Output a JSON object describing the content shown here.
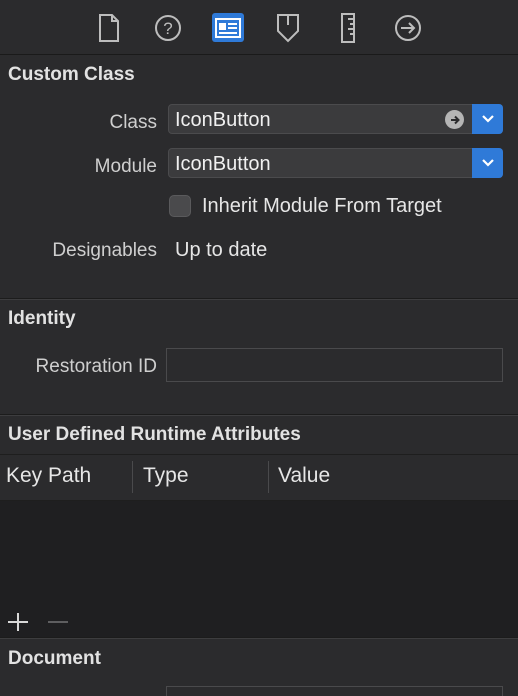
{
  "toolbar": {
    "icons": [
      "file-icon",
      "help-icon",
      "identity-inspector-icon",
      "attributes-inspector-icon",
      "size-inspector-icon",
      "connections-inspector-icon"
    ],
    "active_index": 2,
    "accent": "#2f7ad8"
  },
  "custom_class": {
    "title": "Custom Class",
    "class_label": "Class",
    "class_value": "IconButton",
    "module_label": "Module",
    "module_value": "IconButton",
    "inherit_label": "Inherit Module From Target",
    "designables_label": "Designables",
    "designables_value": "Up to date"
  },
  "identity": {
    "title": "Identity",
    "restoration_label": "Restoration ID",
    "restoration_value": ""
  },
  "runtime_attributes": {
    "title": "User Defined Runtime Attributes",
    "columns": [
      "Key Path",
      "Type",
      "Value"
    ],
    "rows": []
  },
  "document": {
    "title": "Document"
  }
}
